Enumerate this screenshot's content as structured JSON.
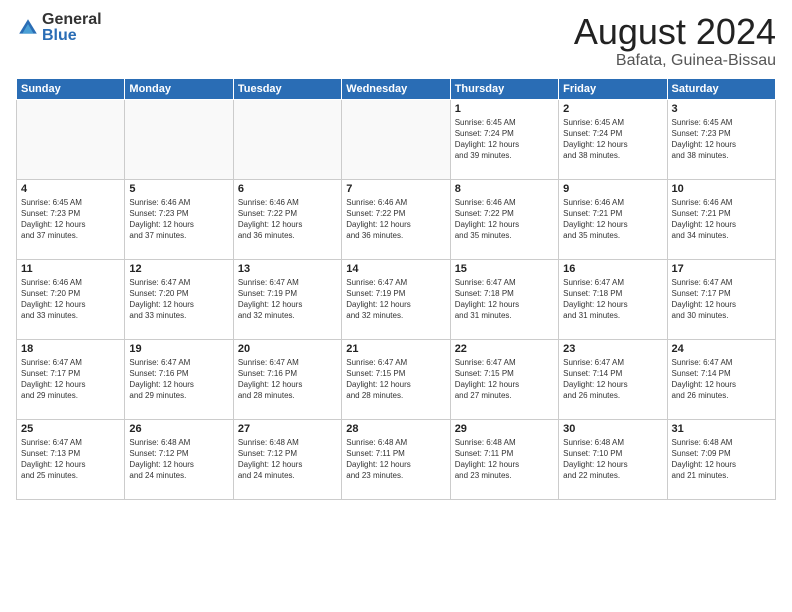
{
  "logo": {
    "general": "General",
    "blue": "Blue"
  },
  "title": "August 2024",
  "location": "Bafata, Guinea-Bissau",
  "days_of_week": [
    "Sunday",
    "Monday",
    "Tuesday",
    "Wednesday",
    "Thursday",
    "Friday",
    "Saturday"
  ],
  "weeks": [
    [
      {
        "day": "",
        "info": ""
      },
      {
        "day": "",
        "info": ""
      },
      {
        "day": "",
        "info": ""
      },
      {
        "day": "",
        "info": ""
      },
      {
        "day": "1",
        "info": "Sunrise: 6:45 AM\nSunset: 7:24 PM\nDaylight: 12 hours\nand 39 minutes."
      },
      {
        "day": "2",
        "info": "Sunrise: 6:45 AM\nSunset: 7:24 PM\nDaylight: 12 hours\nand 38 minutes."
      },
      {
        "day": "3",
        "info": "Sunrise: 6:45 AM\nSunset: 7:23 PM\nDaylight: 12 hours\nand 38 minutes."
      }
    ],
    [
      {
        "day": "4",
        "info": "Sunrise: 6:45 AM\nSunset: 7:23 PM\nDaylight: 12 hours\nand 37 minutes."
      },
      {
        "day": "5",
        "info": "Sunrise: 6:46 AM\nSunset: 7:23 PM\nDaylight: 12 hours\nand 37 minutes."
      },
      {
        "day": "6",
        "info": "Sunrise: 6:46 AM\nSunset: 7:22 PM\nDaylight: 12 hours\nand 36 minutes."
      },
      {
        "day": "7",
        "info": "Sunrise: 6:46 AM\nSunset: 7:22 PM\nDaylight: 12 hours\nand 36 minutes."
      },
      {
        "day": "8",
        "info": "Sunrise: 6:46 AM\nSunset: 7:22 PM\nDaylight: 12 hours\nand 35 minutes."
      },
      {
        "day": "9",
        "info": "Sunrise: 6:46 AM\nSunset: 7:21 PM\nDaylight: 12 hours\nand 35 minutes."
      },
      {
        "day": "10",
        "info": "Sunrise: 6:46 AM\nSunset: 7:21 PM\nDaylight: 12 hours\nand 34 minutes."
      }
    ],
    [
      {
        "day": "11",
        "info": "Sunrise: 6:46 AM\nSunset: 7:20 PM\nDaylight: 12 hours\nand 33 minutes."
      },
      {
        "day": "12",
        "info": "Sunrise: 6:47 AM\nSunset: 7:20 PM\nDaylight: 12 hours\nand 33 minutes."
      },
      {
        "day": "13",
        "info": "Sunrise: 6:47 AM\nSunset: 7:19 PM\nDaylight: 12 hours\nand 32 minutes."
      },
      {
        "day": "14",
        "info": "Sunrise: 6:47 AM\nSunset: 7:19 PM\nDaylight: 12 hours\nand 32 minutes."
      },
      {
        "day": "15",
        "info": "Sunrise: 6:47 AM\nSunset: 7:18 PM\nDaylight: 12 hours\nand 31 minutes."
      },
      {
        "day": "16",
        "info": "Sunrise: 6:47 AM\nSunset: 7:18 PM\nDaylight: 12 hours\nand 31 minutes."
      },
      {
        "day": "17",
        "info": "Sunrise: 6:47 AM\nSunset: 7:17 PM\nDaylight: 12 hours\nand 30 minutes."
      }
    ],
    [
      {
        "day": "18",
        "info": "Sunrise: 6:47 AM\nSunset: 7:17 PM\nDaylight: 12 hours\nand 29 minutes."
      },
      {
        "day": "19",
        "info": "Sunrise: 6:47 AM\nSunset: 7:16 PM\nDaylight: 12 hours\nand 29 minutes."
      },
      {
        "day": "20",
        "info": "Sunrise: 6:47 AM\nSunset: 7:16 PM\nDaylight: 12 hours\nand 28 minutes."
      },
      {
        "day": "21",
        "info": "Sunrise: 6:47 AM\nSunset: 7:15 PM\nDaylight: 12 hours\nand 28 minutes."
      },
      {
        "day": "22",
        "info": "Sunrise: 6:47 AM\nSunset: 7:15 PM\nDaylight: 12 hours\nand 27 minutes."
      },
      {
        "day": "23",
        "info": "Sunrise: 6:47 AM\nSunset: 7:14 PM\nDaylight: 12 hours\nand 26 minutes."
      },
      {
        "day": "24",
        "info": "Sunrise: 6:47 AM\nSunset: 7:14 PM\nDaylight: 12 hours\nand 26 minutes."
      }
    ],
    [
      {
        "day": "25",
        "info": "Sunrise: 6:47 AM\nSunset: 7:13 PM\nDaylight: 12 hours\nand 25 minutes."
      },
      {
        "day": "26",
        "info": "Sunrise: 6:48 AM\nSunset: 7:12 PM\nDaylight: 12 hours\nand 24 minutes."
      },
      {
        "day": "27",
        "info": "Sunrise: 6:48 AM\nSunset: 7:12 PM\nDaylight: 12 hours\nand 24 minutes."
      },
      {
        "day": "28",
        "info": "Sunrise: 6:48 AM\nSunset: 7:11 PM\nDaylight: 12 hours\nand 23 minutes."
      },
      {
        "day": "29",
        "info": "Sunrise: 6:48 AM\nSunset: 7:11 PM\nDaylight: 12 hours\nand 23 minutes."
      },
      {
        "day": "30",
        "info": "Sunrise: 6:48 AM\nSunset: 7:10 PM\nDaylight: 12 hours\nand 22 minutes."
      },
      {
        "day": "31",
        "info": "Sunrise: 6:48 AM\nSunset: 7:09 PM\nDaylight: 12 hours\nand 21 minutes."
      }
    ]
  ]
}
